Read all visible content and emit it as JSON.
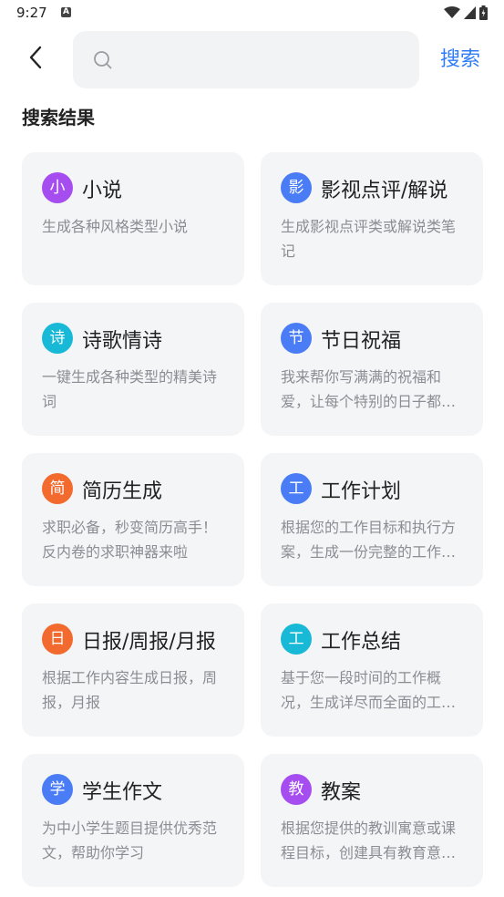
{
  "status_bar": {
    "time": "9:27",
    "notification_letter": "A"
  },
  "header": {
    "search_placeholder": "",
    "search_button": "搜索"
  },
  "section_title": "搜索结果",
  "colors": {
    "accent": "#2f7cf6",
    "card_bg": "#f4f5f7"
  },
  "cards": [
    {
      "badge": "小",
      "badge_color": "#a64df0",
      "title": "小说",
      "desc": "生成各种风格类型小说"
    },
    {
      "badge": "影",
      "badge_color": "#4a7cf5",
      "title": "影视点评/解说",
      "desc": "生成影视点评类或解说类笔记"
    },
    {
      "badge": "诗",
      "badge_color": "#18b9d6",
      "title": "诗歌情诗",
      "desc": "一键生成各种类型的精美诗词"
    },
    {
      "badge": "节",
      "badge_color": "#4a7cf5",
      "title": "节日祝福",
      "desc": "我来帮你写满满的祝福和爱，让每个特别的日子都充满温暖"
    },
    {
      "badge": "简",
      "badge_color": "#f26a2e",
      "title": "简历生成",
      "desc": "求职必备，秒变简历高手！反内卷的求职神器来啦"
    },
    {
      "badge": "工",
      "badge_color": "#4a7cf5",
      "title": "工作计划",
      "desc": "根据您的工作目标和执行方案，生成一份完整的工作计划"
    },
    {
      "badge": "日",
      "badge_color": "#f26a2e",
      "title": "日报/周报/月报",
      "desc": "根据工作内容生成日报，周报，月报"
    },
    {
      "badge": "工",
      "badge_color": "#18b9d6",
      "title": "工作总结",
      "desc": "基于您一段时间的工作概况，生成详尽而全面的工作总结"
    },
    {
      "badge": "学",
      "badge_color": "#4a7cf5",
      "title": "学生作文",
      "desc": "为中小学生题目提供优秀范文，帮助你学习"
    },
    {
      "badge": "教",
      "badge_color": "#a64df0",
      "title": "教案",
      "desc": "根据您提供的教训寓意或课程目标，创建具有教育意义的教案"
    }
  ]
}
